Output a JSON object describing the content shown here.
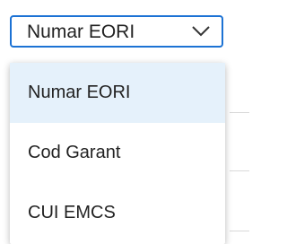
{
  "select": {
    "value": "Numar EORI",
    "icon": "chevron-down-icon",
    "accent_color": "#1c72d4"
  },
  "dropdown": {
    "options": [
      {
        "label": "Numar EORI",
        "selected": true
      },
      {
        "label": "Cod Garant",
        "selected": false
      },
      {
        "label": "CUI EMCS",
        "selected": false
      }
    ],
    "selected_background": "#e5f1fb"
  }
}
